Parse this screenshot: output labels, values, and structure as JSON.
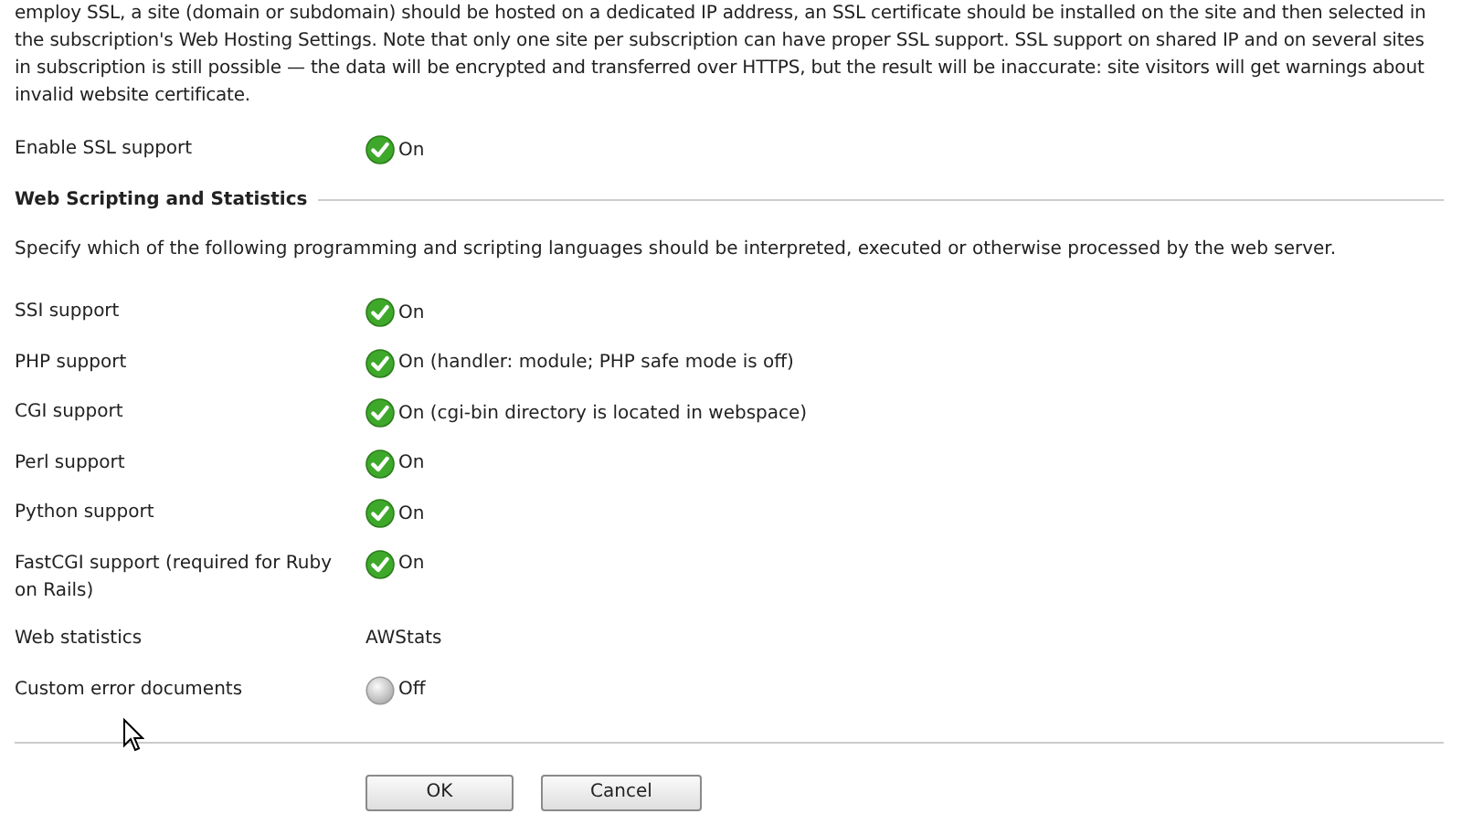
{
  "intro": "employ SSL, a site (domain or subdomain) should be hosted on a dedicated IP address, an SSL certificate should be installed on the site and then selected in the subscription's Web Hosting Settings. Note that only one site per subscription can have proper SSL support. SSL support on shared IP and on several sites in subscription is still possible — the data will be encrypted and transferred over HTTPS, but the result will be inaccurate: site visitors will get warnings about invalid website certificate.",
  "ssl": {
    "label": "Enable SSL support",
    "kind": "status",
    "on": true,
    "value": "On"
  },
  "section": {
    "title": "Web Scripting and Statistics",
    "description": "Specify which of the following programming and scripting languages should be interpreted, executed or otherwise processed by the web server.",
    "rows": [
      {
        "label": "SSI support",
        "kind": "status",
        "on": true,
        "value": "On"
      },
      {
        "label": "PHP support",
        "kind": "status",
        "on": true,
        "value": "On (handler: module; PHP safe mode is off)"
      },
      {
        "label": "CGI support",
        "kind": "status",
        "on": true,
        "value": "On (cgi-bin directory is located in webspace)"
      },
      {
        "label": "Perl support",
        "kind": "status",
        "on": true,
        "value": "On"
      },
      {
        "label": "Python support",
        "kind": "status",
        "on": true,
        "value": "On"
      },
      {
        "label": "FastCGI support (required for Ruby on Rails)",
        "kind": "status",
        "on": true,
        "value": "On"
      },
      {
        "label": "Web statistics",
        "kind": "text",
        "value": "AWStats"
      },
      {
        "label": "Custom error documents",
        "kind": "status",
        "on": false,
        "value": "Off"
      }
    ]
  },
  "buttons": [
    "OK",
    "Cancel"
  ]
}
